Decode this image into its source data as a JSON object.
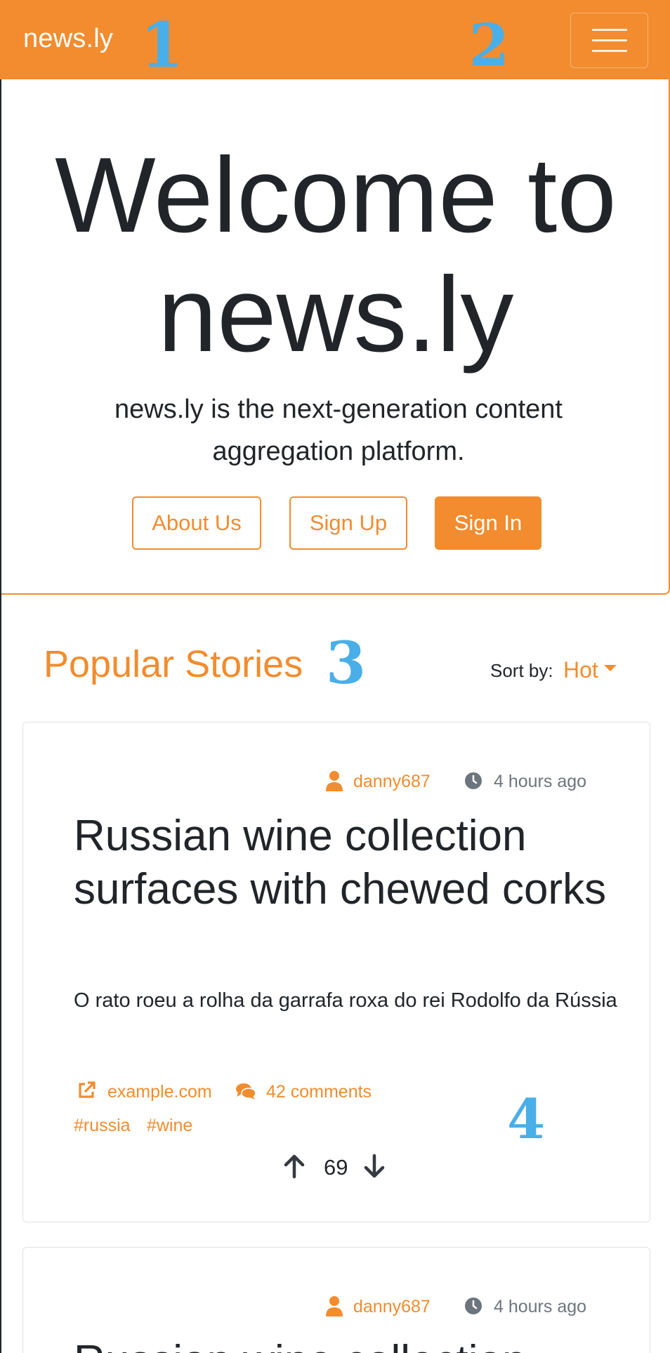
{
  "navbar": {
    "brand": "news.ly",
    "markers": [
      "1",
      "2"
    ],
    "accent_color": "#f28c2e",
    "menu_icon": "hamburger-menu-icon"
  },
  "hero": {
    "title": "Welcome to news.ly",
    "lead": "news.ly is the next-generation content aggregation platform.",
    "buttons": {
      "about": "About Us",
      "signup": "Sign Up",
      "signin": "Sign In"
    }
  },
  "popular": {
    "title": "Popular Stories",
    "marker": "3",
    "sort_label": "Sort by:",
    "sort_value": "Hot"
  },
  "stories": [
    {
      "author": "danny687",
      "time": "4 hours ago",
      "title": "Russian wine collection surfaces with chewed corks",
      "excerpt": "O rato roeu a rolha da garrafa roxa do rei Rodolfo da Rússia",
      "link": "example.com",
      "comments": "42 comments",
      "tags": [
        "#russia",
        "#wine"
      ],
      "votes": "69",
      "marker": "4"
    },
    {
      "author": "danny687",
      "time": "4 hours ago",
      "title": "Russian wine collection"
    }
  ],
  "icons": {
    "user": "user-icon",
    "clock": "clock-icon",
    "external_link": "external-link-icon",
    "comments": "comments-icon",
    "upvote": "arrow-up-icon",
    "downvote": "arrow-down-icon"
  },
  "colors": {
    "accent": "#f28c2e",
    "marker": "#4aaee8",
    "muted": "#6c757d"
  }
}
